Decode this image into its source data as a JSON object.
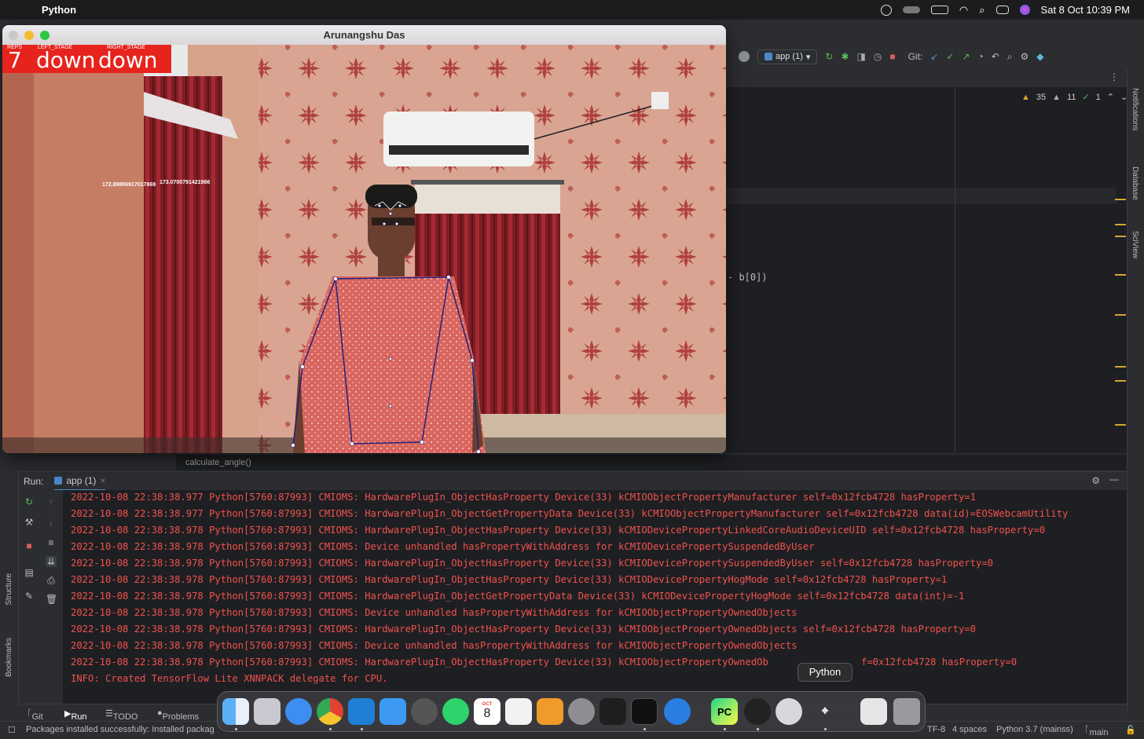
{
  "menubar": {
    "app_name": "Python",
    "datetime": "Sat 8 Oct  10:39 PM"
  },
  "camera_window": {
    "title": "Arunangshu Das",
    "overlay": {
      "reps_label": "REPS",
      "left_stage_label": "LEFT_STAGE",
      "right_stage_label": "RIGHT_STAGE",
      "reps_value": "7",
      "left_stage_value": "down",
      "right_stage_value": "down"
    },
    "angle_text_1": "172.89886917017869",
    "angle_text_2": "173.0700791421966"
  },
  "toolbar": {
    "run_config": "app (1)",
    "git_label": "Git:"
  },
  "inspections": {
    "warnings": "35",
    "weak_warnings": "11",
    "ok": "1"
  },
  "editor": {
    "code_fragment": "- b[0])",
    "breadcrumb": "calculate_angle()"
  },
  "right_sidebar": {
    "notifications": "Notifications",
    "database": "Database",
    "sciview": "SciView"
  },
  "run_panel": {
    "label": "Run:",
    "tab": "app (1)",
    "lines": [
      "2022-10-08 22:38:38.977 Python[5760:87993] CMIOMS: HardwarePlugIn_ObjectHasProperty Device(33) kCMIOObjectPropertyManufacturer self=0x12fcb4728 hasProperty=1",
      "2022-10-08 22:38:38.977 Python[5760:87993] CMIOMS: HardwarePlugIn_ObjectGetPropertyData Device(33) kCMIOObjectPropertyManufacturer self=0x12fcb4728 data(id)=EOSWebcamUtility",
      "2022-10-08 22:38:38.978 Python[5760:87993] CMIOMS: HardwarePlugIn_ObjectHasProperty Device(33) kCMIODevicePropertyLinkedCoreAudioDeviceUID self=0x12fcb4728 hasProperty=0",
      "2022-10-08 22:38:38.978 Python[5760:87993] CMIOMS: Device unhandled hasPropertyWithAddress for kCMIODevicePropertySuspendedByUser",
      "2022-10-08 22:38:38.978 Python[5760:87993] CMIOMS: HardwarePlugIn_ObjectHasProperty Device(33) kCMIODevicePropertySuspendedByUser self=0x12fcb4728 hasProperty=0",
      "2022-10-08 22:38:38.978 Python[5760:87993] CMIOMS: HardwarePlugIn_ObjectHasProperty Device(33) kCMIODevicePropertyHogMode self=0x12fcb4728 hasProperty=1",
      "2022-10-08 22:38:38.978 Python[5760:87993] CMIOMS: HardwarePlugIn_ObjectGetPropertyData Device(33) kCMIODevicePropertyHogMode self=0x12fcb4728 data(int)=-1",
      "2022-10-08 22:38:38.978 Python[5760:87993] CMIOMS: Device unhandled hasPropertyWithAddress for kCMIOObjectPropertyOwnedObjects",
      "2022-10-08 22:38:38.978 Python[5760:87993] CMIOMS: HardwarePlugIn_ObjectHasProperty Device(33) kCMIOObjectPropertyOwnedObjects self=0x12fcb4728 hasProperty=0",
      "2022-10-08 22:38:38.978 Python[5760:87993] CMIOMS: Device unhandled hasPropertyWithAddress for kCMIOObjectPropertyOwnedObjects",
      "2022-10-08 22:38:38.978 Python[5760:87993] CMIOMS: HardwarePlugIn_ObjectHasProperty Device(33) kCMIOObjectPropertyOwnedOb",
      "INFO: Created TensorFlow Lite XNNPACK delegate for CPU."
    ],
    "line_tail": "f=0x12fcb4728 hasProperty=0"
  },
  "left_sidebar": {
    "structure": "Structure",
    "bookmarks": "Bookmarks"
  },
  "bottom_tabs": {
    "git": "Git",
    "run": "Run",
    "todo": "TODO",
    "problems": "Problems"
  },
  "statusbar": {
    "message": "Packages installed successfully: Installed packag",
    "encoding": "TF-8",
    "indent": "4 spaces",
    "interpreter": "Python 3.7 (mainss)",
    "branch": "main"
  },
  "dock": {
    "tooltip": "Python",
    "calendar_month": "OCT",
    "calendar_day": "8",
    "pycharm_label": "PC"
  }
}
